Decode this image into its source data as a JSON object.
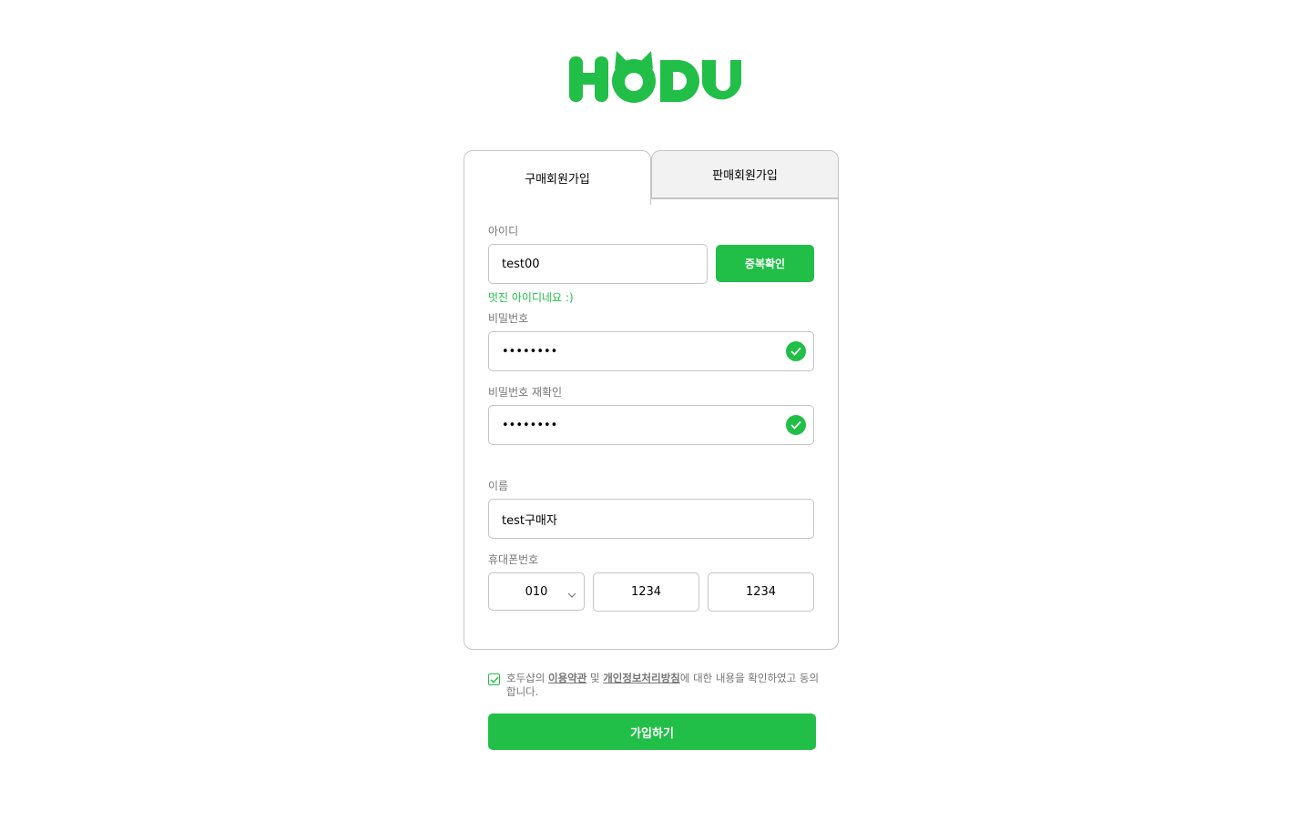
{
  "brand": {
    "logo_text": "HODU",
    "accent_color": "#21bf48"
  },
  "tabs": [
    {
      "label": "구매회원가입",
      "active": true
    },
    {
      "label": "판매회원가입",
      "active": false
    }
  ],
  "form": {
    "id": {
      "label": "아이디",
      "value": "test00",
      "check_button": "중복확인",
      "message": "멋진 아이디네요 :)"
    },
    "password": {
      "label": "비밀번호",
      "value": "••••••••",
      "status_icon": "check-icon"
    },
    "password_confirm": {
      "label": "비밀번호 재확인",
      "value": "••••••••",
      "status_icon": "check-icon"
    },
    "name": {
      "label": "이름",
      "value": "test구매자"
    },
    "phone": {
      "label": "휴대폰번호",
      "prefix": "010",
      "middle": "1234",
      "last": "1234"
    }
  },
  "agreement": {
    "checked": true,
    "text_before": "호두샵의 ",
    "terms_link": "이용약관",
    "text_and": " 및 ",
    "privacy_link": "개인정보처리방침",
    "text_after": "에 대한 내용을 확인하였고 동의합니다."
  },
  "submit_button": "가입하기"
}
